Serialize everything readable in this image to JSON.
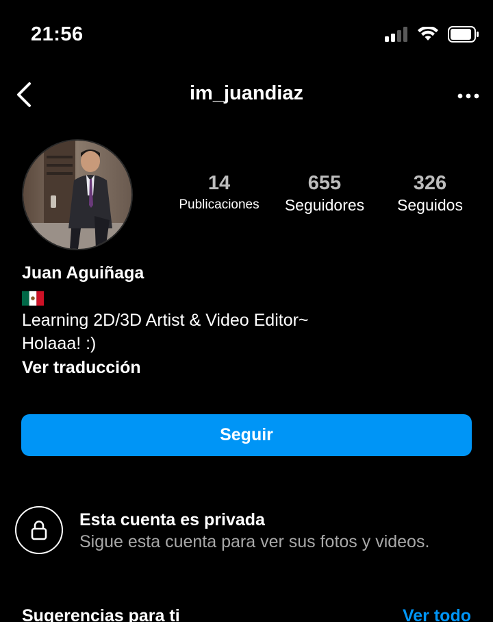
{
  "status_bar": {
    "time": "21:56"
  },
  "header": {
    "username": "im_juandiaz",
    "back_icon": "chevron-left-icon",
    "more_icon": "more-horizontal-icon"
  },
  "profile": {
    "stats": [
      {
        "value": "14",
        "label": "Publicaciones"
      },
      {
        "value": "655",
        "label": "Seguidores"
      },
      {
        "value": "326",
        "label": "Seguidos"
      }
    ],
    "name": "Juan Aguiñaga",
    "flag": "🇲🇽",
    "bio_lines": [
      "Learning 2D/3D Artist & Video Editor~",
      "Holaaa! :)"
    ],
    "translate_label": "Ver traducción"
  },
  "actions": {
    "follow_label": "Seguir"
  },
  "private_notice": {
    "title": "Esta cuenta es privada",
    "subtitle": "Sigue esta cuenta para ver sus fotos y videos."
  },
  "suggestions": {
    "title": "Sugerencias para ti",
    "see_all_label": "Ver todo"
  },
  "colors": {
    "background": "#000000",
    "accent": "#0095f6",
    "muted_text": "#a8a8a8"
  }
}
